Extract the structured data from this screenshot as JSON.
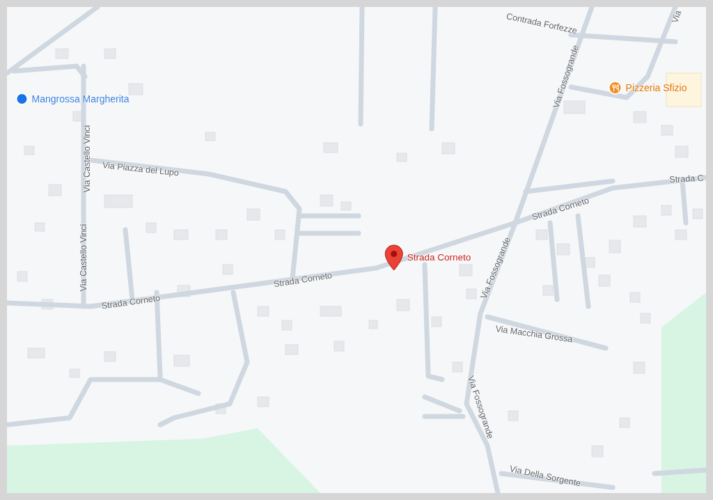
{
  "map": {
    "labels": [
      {
        "text": "Contrada Forfezze",
        "kind": "street"
      },
      {
        "text": "Via",
        "kind": "street"
      },
      {
        "text": "Mangrossa Margherita",
        "kind": "place"
      },
      {
        "text": "Pizzeria Sfizio",
        "kind": "restaurant"
      },
      {
        "text": "Via Fossogrande",
        "kind": "street"
      },
      {
        "text": "Via Piazza del Lupo",
        "kind": "street"
      },
      {
        "text": "Via Castello Vinci",
        "kind": "street"
      },
      {
        "text": "Via Castello Vinci",
        "kind": "street"
      },
      {
        "text": "Strada C",
        "kind": "street"
      },
      {
        "text": "Strada Corneto",
        "kind": "street"
      },
      {
        "text": "Strada Corneto",
        "kind": "pin"
      },
      {
        "text": "Strada Corneto",
        "kind": "street"
      },
      {
        "text": "Strada Corneto",
        "kind": "street"
      },
      {
        "text": "Via Fossogrande",
        "kind": "street"
      },
      {
        "text": "Via Macchia Grossa",
        "kind": "street"
      },
      {
        "text": "Via Fossogrande",
        "kind": "street"
      },
      {
        "text": "Via Della Sorgente",
        "kind": "street"
      }
    ]
  }
}
